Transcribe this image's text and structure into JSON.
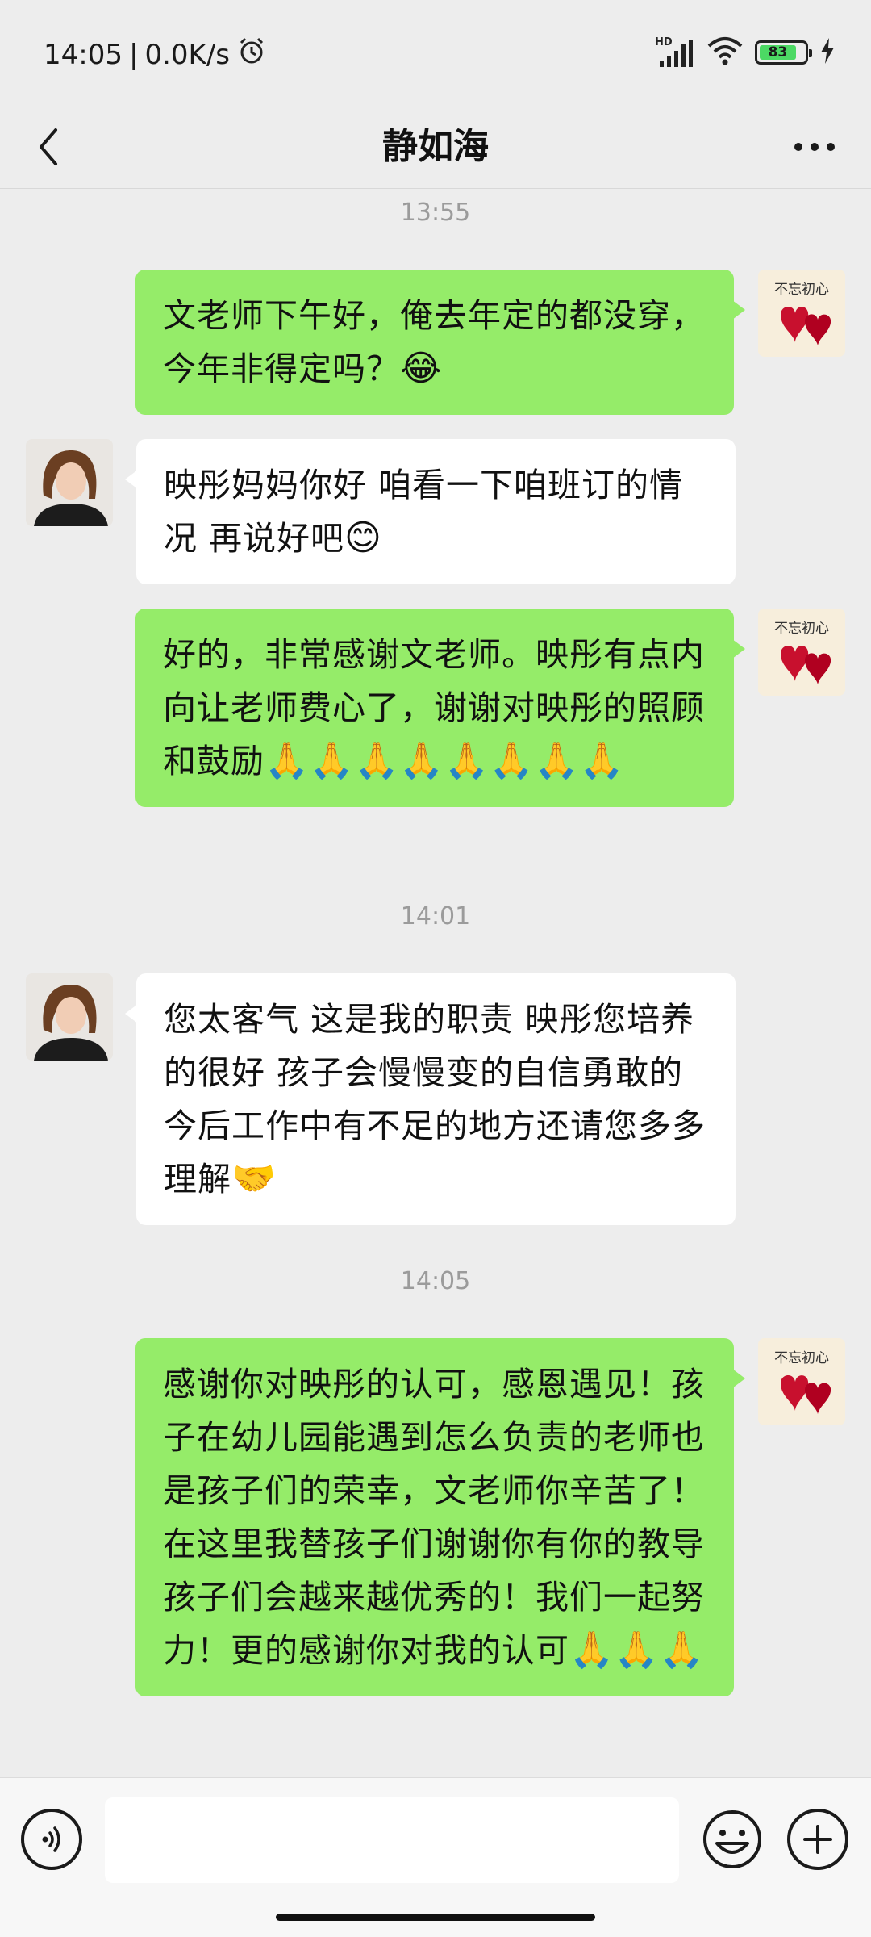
{
  "status_bar": {
    "time": "14:05",
    "speed": "0.0K/s",
    "network": "HD",
    "battery": "83",
    "battery_level": 0.83
  },
  "nav": {
    "title": "静如海"
  },
  "messages": [
    {
      "type": "timestamp",
      "text": "13:55"
    },
    {
      "type": "outgoing",
      "text": "文老师下午好，俺去年定的都没穿，今年非得定吗？",
      "emoji": "😂"
    },
    {
      "type": "incoming",
      "text": "映彤妈妈你好 咱看一下咱班订的情况 再说好吧",
      "emoji": "😊"
    },
    {
      "type": "outgoing",
      "text": "好的，非常感谢文老师。映彤有点内向让老师费心了，谢谢对映彤的照顾和鼓励",
      "emoji": "🙏🙏🙏🙏🙏🙏🙏🙏"
    },
    {
      "type": "timestamp",
      "text": "14:01"
    },
    {
      "type": "incoming",
      "text": "您太客气 这是我的职责 映彤您培养的很好 孩子会慢慢变的自信勇敢的 今后工作中有不足的地方还请您多多理解",
      "emoji": "🤝"
    },
    {
      "type": "timestamp",
      "text": "14:05"
    },
    {
      "type": "outgoing",
      "text": "感谢你对映彤的认可，感恩遇见！孩子在幼儿园能遇到怎么负责的老师也是孩子们的荣幸，文老师你辛苦了！在这里我替孩子们谢谢你有你的教导孩子们会越来越优秀的！我们一起努力！更的感谢你对我的认可",
      "emoji": "🙏🙏🙏"
    }
  ],
  "my_avatar_text": "不忘初心",
  "input": {
    "placeholder": ""
  },
  "colors": {
    "outgoing_bubble": "#95ec69",
    "incoming_bubble": "#ffffff",
    "background": "#ededed"
  }
}
